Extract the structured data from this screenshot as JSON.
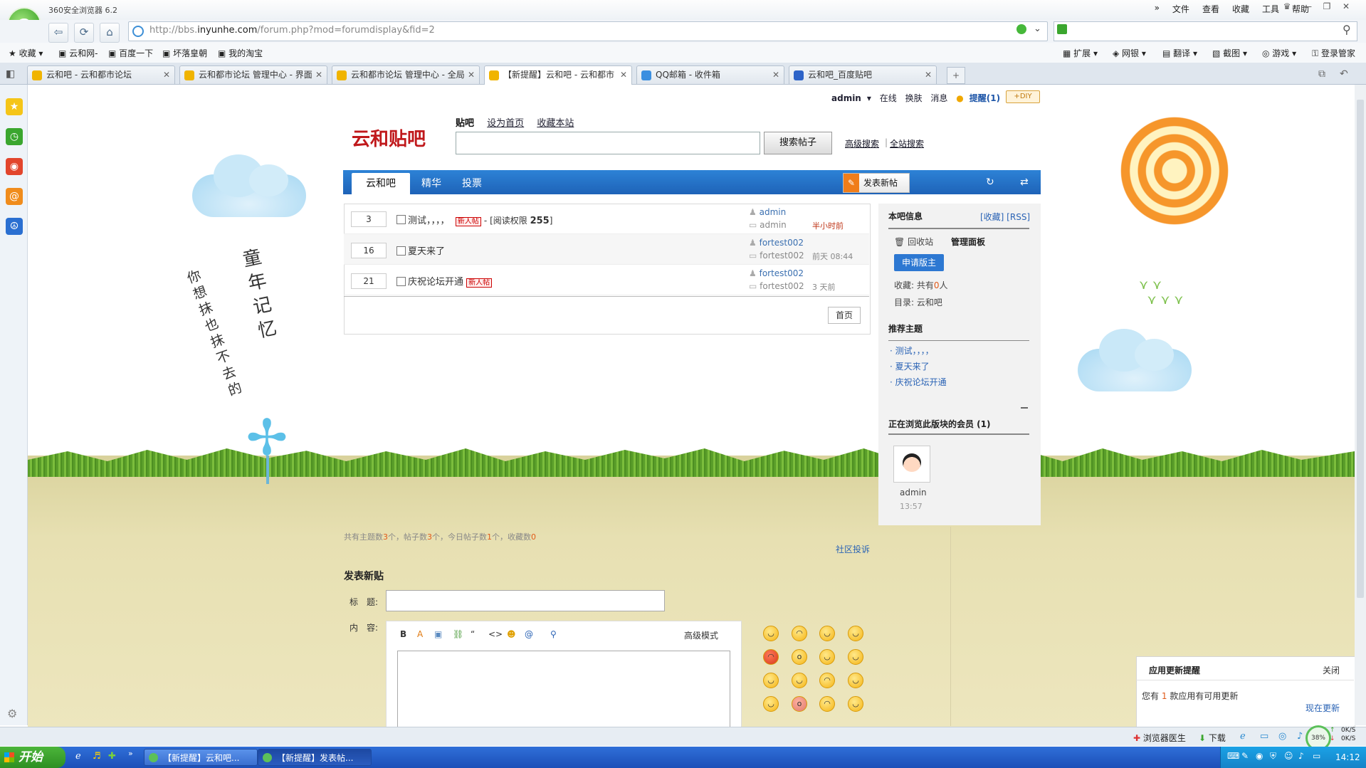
{
  "browser": {
    "app_title": "360安全浏览器 6.2",
    "menu": [
      "文件",
      "查看",
      "收藏",
      "工具",
      "帮助"
    ],
    "url_prefix": "http://bbs.",
    "url_domain": "inyunhe.com",
    "url_path": "/forum.php?mod=forumdisplay&fid=2",
    "bookmarks": [
      "收藏",
      "云和网-",
      "百度一下",
      "坏落皇朝",
      "我的淘宝"
    ],
    "right_tools": [
      "扩展",
      "网银",
      "翻译",
      "截图",
      "游戏",
      "登录管家"
    ],
    "tabs": [
      {
        "label": "云和吧 - 云和都市论坛"
      },
      {
        "label": "云和都市论坛 管理中心 - 界面"
      },
      {
        "label": "云和都市论坛 管理中心 - 全局"
      },
      {
        "label": "【新提醒】云和吧 - 云和都市"
      },
      {
        "label": "QQ邮箱 - 收件箱"
      },
      {
        "label": "云和吧_百度贴吧"
      }
    ],
    "status_items": [
      "浏览器医生",
      "下载"
    ],
    "progress_label": "38%",
    "net_up": "0K/S",
    "net_down": "0K/S"
  },
  "userbar": {
    "user": "admin",
    "items": [
      "在线",
      "换肤",
      "消息",
      "提醒(1)"
    ],
    "diy": "DIY"
  },
  "header": {
    "brand": "云和贴吧",
    "nav_current": "贴吧",
    "nav_links": [
      "设为首页",
      "收藏本站"
    ],
    "search_button": "搜索帖子",
    "advanced_search": "高级搜索",
    "site_search": "全站搜索"
  },
  "forum_nav": {
    "tabs": [
      "云和吧",
      "精华",
      "投票"
    ],
    "post_button": "发表新帖"
  },
  "threads": [
    {
      "count": "3",
      "title": "测试，，，，",
      "tag": "新人帖",
      "extra": "- [阅读权限 ",
      "extra_num": "255",
      "extra_end": "]",
      "author": "admin",
      "last": "admin",
      "time": "半小时前"
    },
    {
      "count": "16",
      "title": "夏天来了",
      "tag": "",
      "author": "fortest002",
      "last": "fortest002",
      "time": "前天 08:44"
    },
    {
      "count": "21",
      "title": "庆祝论坛开通",
      "tag": "新人帖",
      "author": "fortest002",
      "last": "fortest002",
      "time": "3 天前"
    }
  ],
  "pager": {
    "home": "首页"
  },
  "side": {
    "info_title": "本吧信息",
    "info_links": "[收藏] [RSS]",
    "recycle": "回收站",
    "manage": "管理面板",
    "apply": "申请版主",
    "fav_label": "收藏: 共有",
    "fav_count": "0",
    "fav_unit": "人",
    "dir": "目录: 云和吧",
    "recommend_title": "推荐主题",
    "recommend": [
      "测试，，，，",
      "夏天来了",
      "庆祝论坛开通"
    ],
    "browsing_title": "正在浏览此版块的会员 (1)",
    "member_name": "admin",
    "member_time": "13:57"
  },
  "stats": {
    "t1": "共有主题数",
    "v1": "3",
    "u1": "个，帖子数",
    "v2": "3",
    "u2": "个，今日帖子数",
    "v3": "1",
    "u3": "个，收藏数",
    "v4": "0"
  },
  "report": "社区投诉",
  "newpost": {
    "heading": "发表新贴",
    "title_label": "标　题:",
    "content_label": "内　容:",
    "advanced_mode": "高级模式"
  },
  "decor_text": {
    "line1": "童年记忆",
    "line2": "你想抹也抹不去的"
  },
  "notify": {
    "title": "应用更新提醒",
    "close": "关闭",
    "text_pre": "您有",
    "count": "1",
    "text_post": "款应用有可用更新",
    "action": "现在更新"
  },
  "taskbar": {
    "start": "开始",
    "tasks": [
      "【新提醒】云和吧...",
      "【新提醒】发表帖..."
    ],
    "clock": "14:12"
  }
}
